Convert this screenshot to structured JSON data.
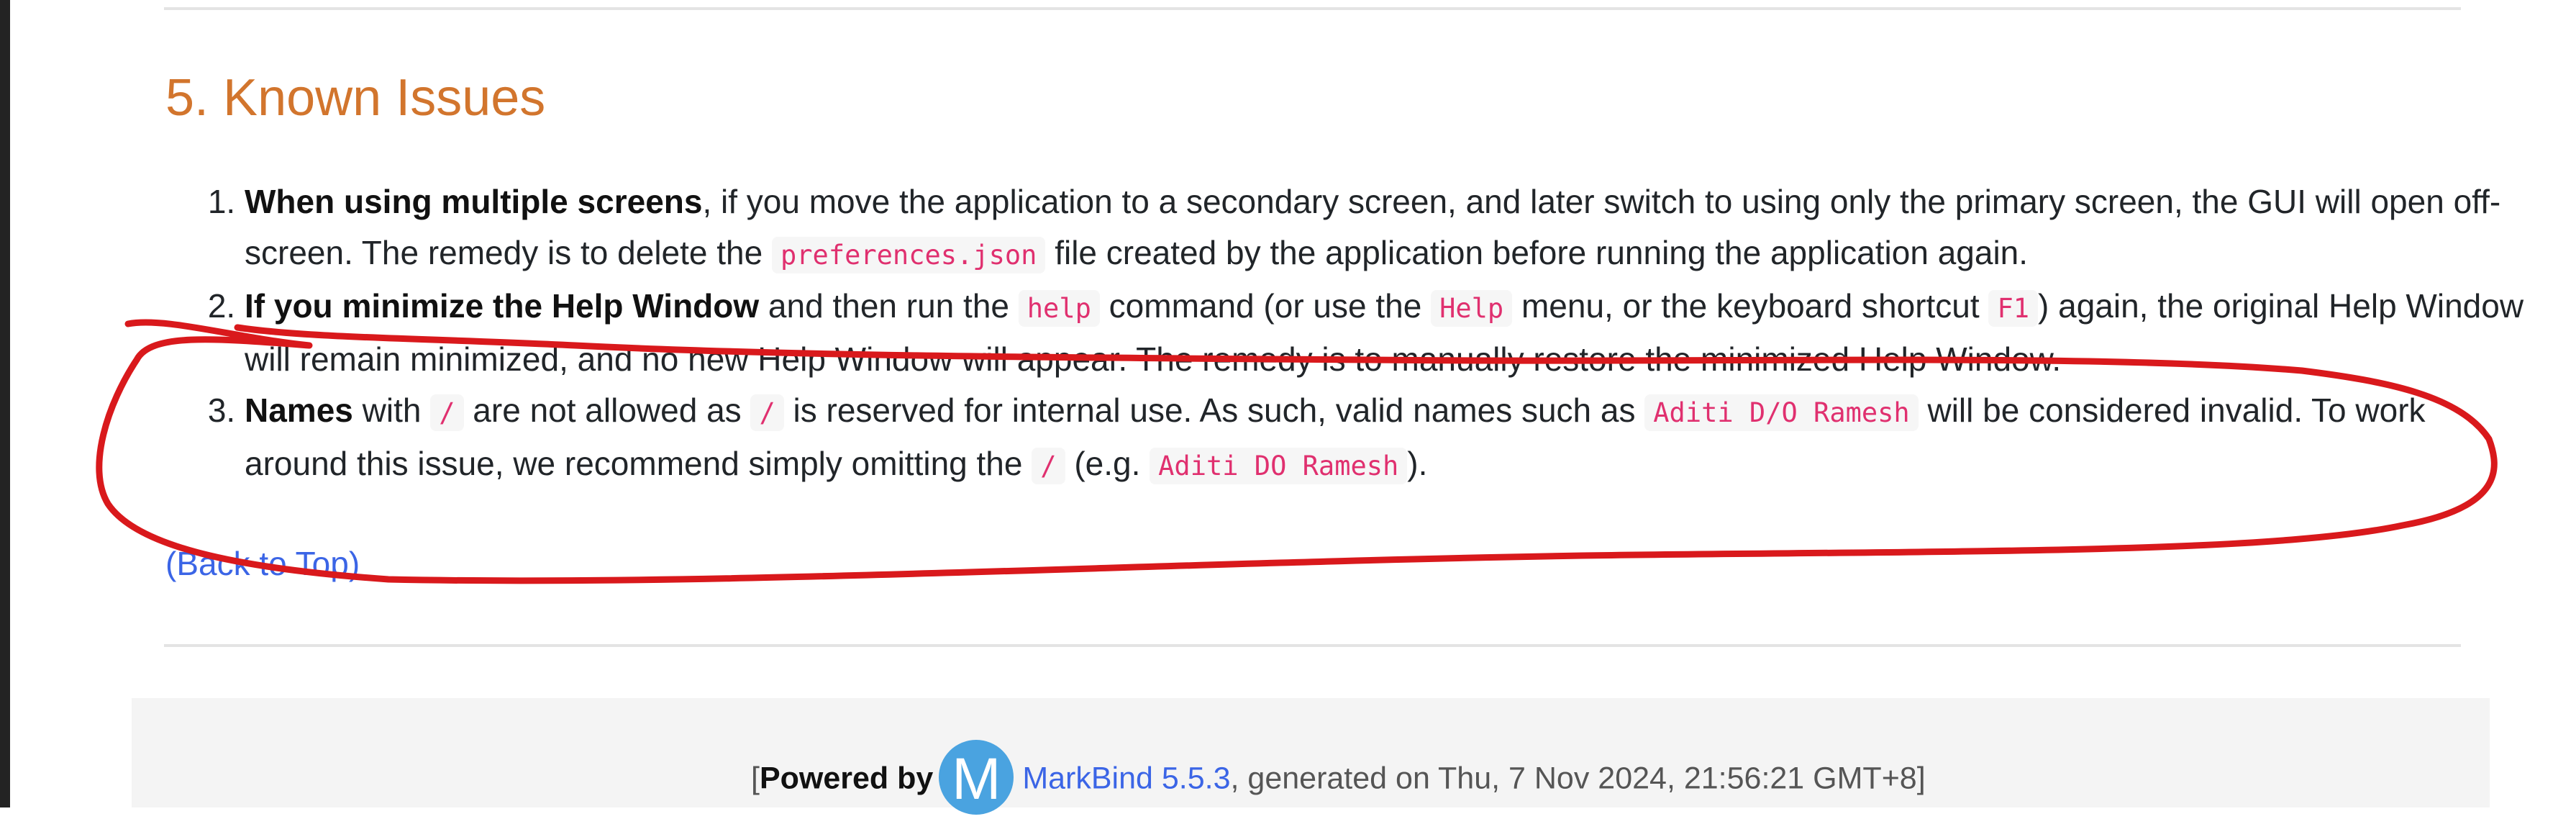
{
  "section": {
    "title": "5. Known Issues"
  },
  "issues": [
    {
      "bold": "When using multiple screens",
      "text1": ", if you move the application to a secondary screen, and later switch to using only the primary screen, the GUI will open off-screen. The remedy is to delete the ",
      "code1": "preferences.json",
      "text2": " file created by the application before running the application again."
    },
    {
      "bold": "If you minimize the Help Window",
      "text1": " and then run the ",
      "code1": "help",
      "text2": " command (or use the ",
      "code2": "Help",
      "text3": " menu, or the keyboard shortcut ",
      "code3": "F1",
      "text4": ") again, the original Help Window will remain minimized, and no new Help Window will appear. The remedy is to manually restore the minimized Help Window."
    },
    {
      "bold": "Names",
      "text1": " with ",
      "code1": "/",
      "text2": " are not allowed as ",
      "code2": "/",
      "text3": " is reserved for internal use. As such, valid names such as ",
      "code3": "Aditi D/O Ramesh",
      "text4": " will be considered invalid. To work around this issue, we recommend simply omitting the ",
      "code4": "/",
      "text5": " (e.g. ",
      "code5": "Aditi DO Ramesh",
      "text6": ")."
    }
  ],
  "back_to_top": "(Back to Top)",
  "footer": {
    "open_bracket": "[",
    "powered_by": "Powered by",
    "logo_letter": "M",
    "markbind_link": "MarkBind 5.5.3",
    "generated": ", generated on Thu, 7 Nov 2024, 21:56:21 GMT+8]"
  },
  "colors": {
    "heading": "#d2752d",
    "link": "#3b65e6",
    "code": "#e0306f",
    "annotation": "#d9191c"
  }
}
